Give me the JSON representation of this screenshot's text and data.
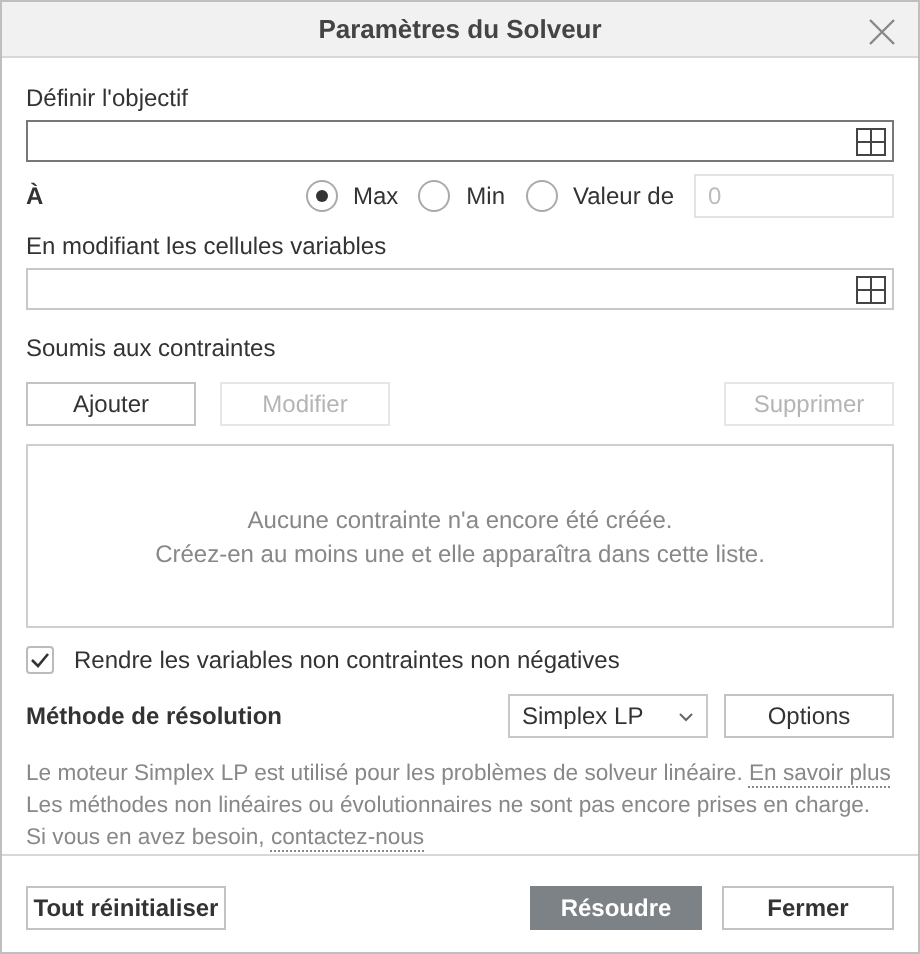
{
  "window": {
    "title": "Paramètres du Solveur"
  },
  "objective": {
    "label": "Définir l'objectif"
  },
  "to": {
    "label": "À",
    "options": [
      {
        "label": "Max",
        "selected": true
      },
      {
        "label": "Min",
        "selected": false
      },
      {
        "label": "Valeur de",
        "selected": false
      }
    ],
    "value_placeholder": "0"
  },
  "variables": {
    "label": "En modifiant les cellules variables"
  },
  "constraints": {
    "label": "Soumis aux contraintes",
    "buttons": [
      {
        "label": "Ajouter",
        "disabled": false
      },
      {
        "label": "Modifier",
        "disabled": true
      },
      {
        "label": "Supprimer",
        "disabled": true
      }
    ],
    "empty_lines": [
      "Aucune contrainte n'a encore été créée.",
      "Créez-en au moins une et elle apparaîtra dans cette liste."
    ]
  },
  "nonnegative": {
    "label": "Rendre les variables non contraintes non négatives",
    "checked": true
  },
  "method": {
    "label": "Méthode de résolution",
    "value": "Simplex LP",
    "options_button": "Options"
  },
  "description": {
    "text1": "Le moteur Simplex LP est utilisé pour les problèmes de solveur linéaire.",
    "link1": "En savoir plus",
    "text2": "Les méthodes non linéaires ou évolutionnaires ne sont pas encore prises en charge. Si vous en avez besoin,",
    "link2": "contactez-nous"
  },
  "footer": {
    "reset": "Tout réinitialiser",
    "solve": "Résoudre",
    "close": "Fermer"
  }
}
